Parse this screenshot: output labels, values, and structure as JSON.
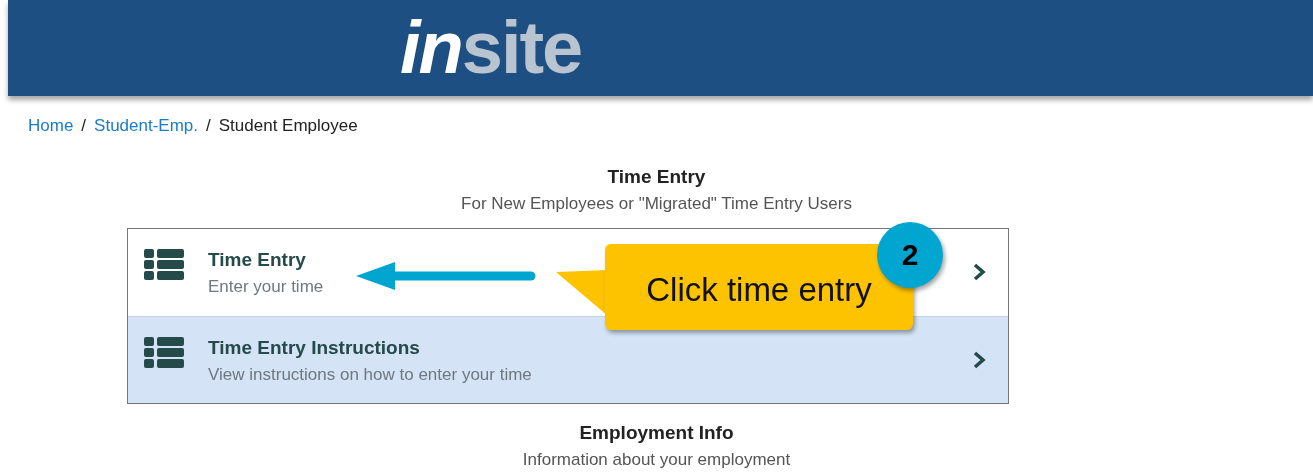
{
  "header": {
    "logo": {
      "lead": "in",
      "rest": "site"
    }
  },
  "breadcrumb": [
    {
      "label": "Home",
      "link": true
    },
    {
      "separator": "/",
      "label": "Student-Emp.",
      "link": true
    },
    {
      "separator": "/",
      "label": "Student Employee",
      "link": false
    }
  ],
  "sections": [
    {
      "title": "Time Entry",
      "subtitle": "For New Employees or \"Migrated\" Time Entry Users",
      "items": [
        {
          "title": "Time Entry",
          "description": "Enter your time",
          "selected": false
        },
        {
          "title": "Time Entry Instructions",
          "description": "View instructions on how to enter your time",
          "selected": true
        }
      ]
    },
    {
      "title": "Employment Info",
      "subtitle": "Information about your employment"
    }
  ],
  "annotation": {
    "text": "Click time entry",
    "step": "2"
  }
}
